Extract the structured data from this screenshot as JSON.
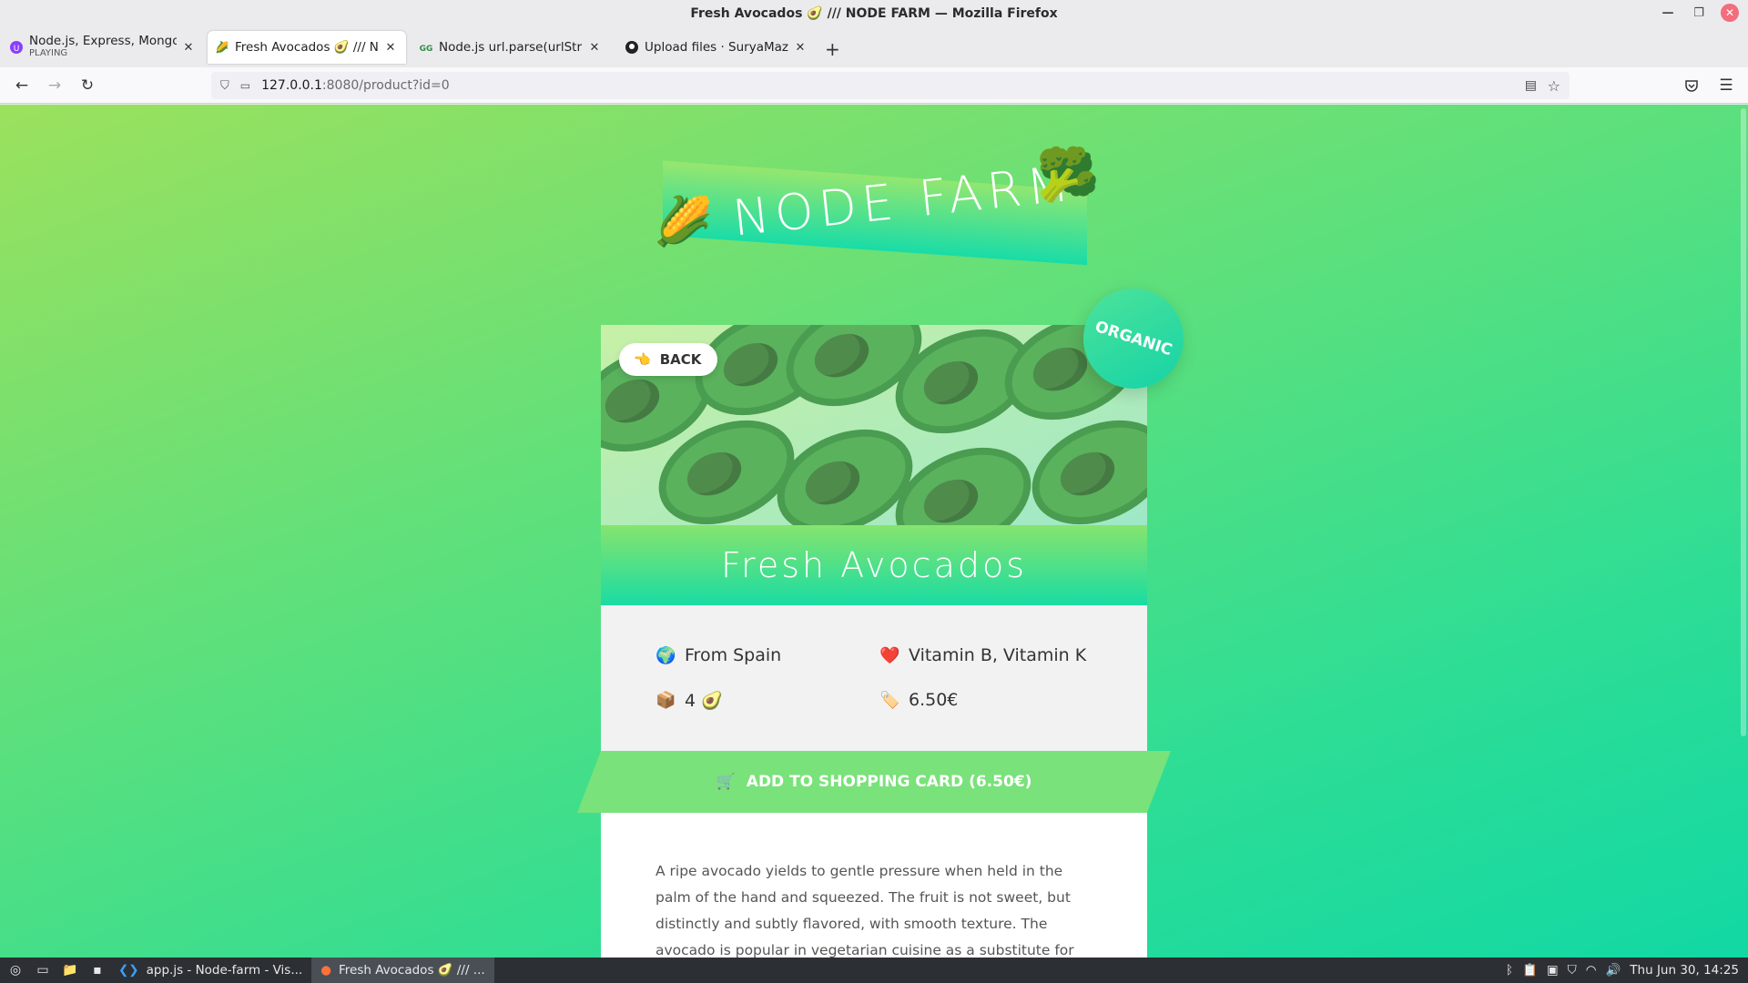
{
  "window": {
    "title": "Fresh Avocados 🥑 /// NODE FARM — Mozilla Firefox"
  },
  "tabs": [
    {
      "label": "Node.js, Express, MongoDB",
      "sublabel": "PLAYING",
      "favicon": "purple-circle-icon"
    },
    {
      "label": "Fresh Avocados 🥑 /// NODE",
      "favicon": "corn-icon"
    },
    {
      "label": "Node.js url.parse(urlString,",
      "favicon": "gfg-icon"
    },
    {
      "label": "Upload files · SuryaMazumd",
      "favicon": "github-icon"
    }
  ],
  "nav": {
    "url_host": "127.0.0.1",
    "url_path": ":8080/product?id=0"
  },
  "page": {
    "logo_text": "NODE FARM",
    "back_label": "BACK",
    "badge": "ORGANIC",
    "product_name": "Fresh Avocados",
    "origin": "From Spain",
    "nutrients": "Vitamin B, Vitamin K",
    "quantity": "4 🥑",
    "price": "6.50€",
    "cta_label": "ADD TO SHOPPING CARD (6.50€)",
    "description": "A ripe avocado yields to gentle pressure when held in the palm of the hand and squeezed. The fruit is not sweet, but distinctly and subtly flavored, with smooth texture. The avocado is popular in vegetarian cuisine as a substitute for meats in sandwiches and"
  },
  "taskbar": {
    "tasks": [
      {
        "label": "app.js - Node-farm - Vis..."
      },
      {
        "label": "Fresh Avocados 🥑 /// ..."
      }
    ],
    "clock": "Thu Jun 30, 14:25"
  }
}
